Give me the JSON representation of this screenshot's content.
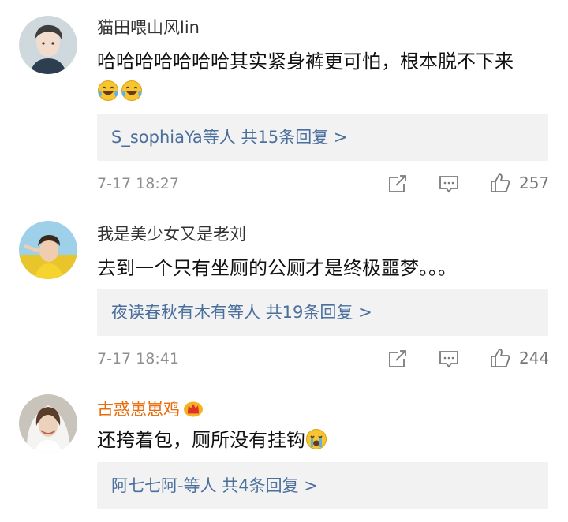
{
  "comments": [
    {
      "username": "猫田喂山风lin",
      "text_line1": "哈哈哈哈哈哈哈其实紧身裤更可怕，根本脱不下来",
      "emoji_line": [
        "laughing-tears-emoji",
        "laughing-tears-emoji"
      ],
      "reply_who": "S_sophiaYa等人",
      "reply_count": "共15条回复 >",
      "time": "7-17 18:27",
      "likes": "257"
    },
    {
      "username": "我是美少女又是老刘",
      "text_line1": "去到一个只有坐厕的公厕才是终极噩梦。。。",
      "reply_who": "夜读春秋有木有等人",
      "reply_count": "共19条回复 >",
      "time": "7-17 18:41",
      "likes": "244"
    },
    {
      "username": "古惑崽崽鸡",
      "username_color": "#e86b0c",
      "text_line1": "还挎着包，厕所没有挂钩",
      "text_emoji": "crying-emoji",
      "reply_who": "阿七七阿-等人",
      "reply_count": "共4条回复 >"
    }
  ],
  "icons": {
    "share": "share-icon",
    "comment": "comment-icon",
    "like": "thumbs-up-icon"
  },
  "colors": {
    "link": "#4a6f9c",
    "vip_name": "#e86b0c",
    "reply_bg": "#f2f2f2",
    "meta": "#8e8e8e"
  }
}
